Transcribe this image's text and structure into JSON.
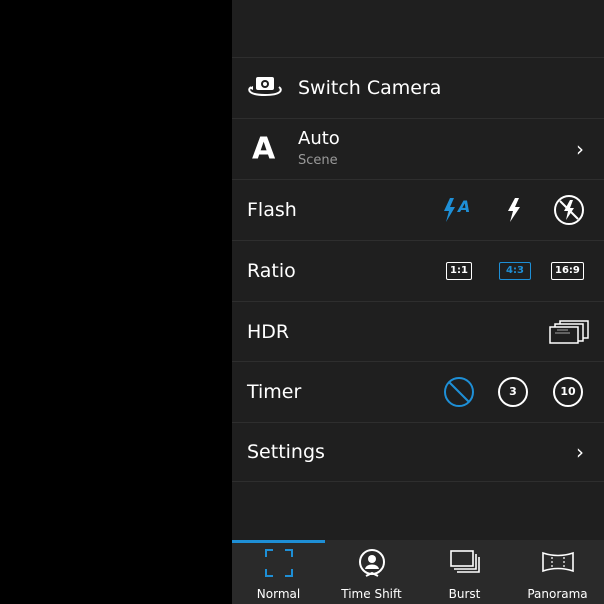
{
  "menu": {
    "switch_camera": "Switch Camera",
    "scene_letter": "A",
    "scene_value": "Auto",
    "scene_label": "Scene",
    "flash_label": "Flash",
    "flash_auto_text": "A",
    "ratio_label": "Ratio",
    "ratio_options": [
      "1:1",
      "4:3",
      "16:9"
    ],
    "ratio_selected": "4:3",
    "hdr_label": "HDR",
    "timer_label": "Timer",
    "timer_options": [
      "3",
      "10"
    ],
    "settings_label": "Settings"
  },
  "tabs": [
    {
      "label": "Normal",
      "icon": "normal-frame-icon",
      "selected": true
    },
    {
      "label": "Time Shift",
      "icon": "time-shift-icon",
      "selected": false
    },
    {
      "label": "Burst",
      "icon": "burst-icon",
      "selected": false
    },
    {
      "label": "Panorama",
      "icon": "panorama-icon",
      "selected": false
    }
  ],
  "colors": {
    "accent": "#1e8fd6",
    "panel": "#1f1f1f",
    "tabbar": "#2a2a2a"
  }
}
